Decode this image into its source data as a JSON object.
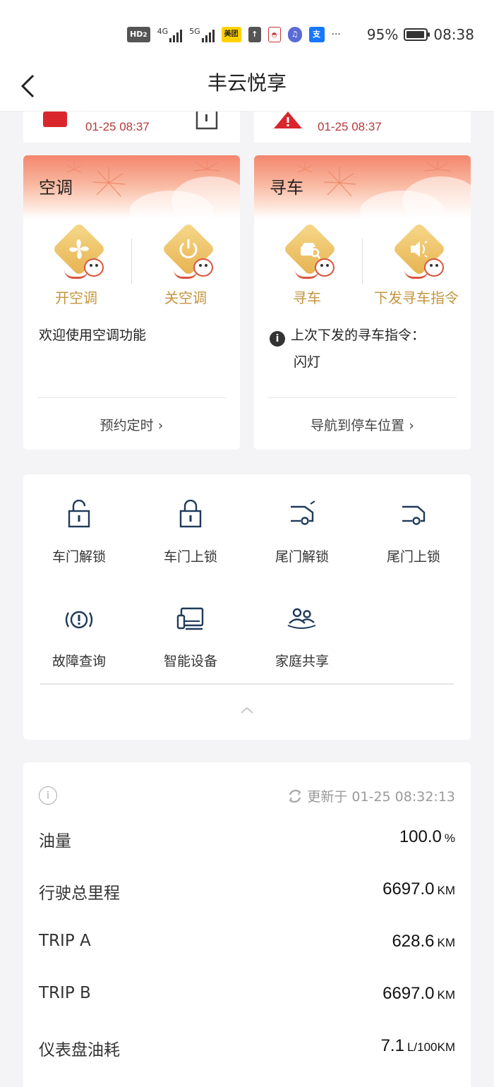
{
  "status_bar": {
    "hd": "HD",
    "hd_sub": "2",
    "net1": "4G",
    "net2": "5G",
    "meituan": "美团",
    "battery_percent": "95%",
    "battery_level": 0.95,
    "time": "08:38"
  },
  "nav": {
    "title": "丰云悦享"
  },
  "top_cards": [
    {
      "time": "01-25 08:37"
    },
    {
      "time": "01-25 08:37"
    }
  ],
  "ac_card": {
    "title": "空调",
    "actions": [
      {
        "label": "开空调",
        "icon": "fan-icon"
      },
      {
        "label": "关空调",
        "icon": "power-icon"
      }
    ],
    "message": "欢迎使用空调功能",
    "link": "预约定时"
  },
  "find_card": {
    "title": "寻车",
    "actions": [
      {
        "label": "寻车",
        "icon": "car-search-icon"
      },
      {
        "label": "下发寻车指令",
        "icon": "speaker-icon"
      }
    ],
    "message_line1": "上次下发的寻车指令：",
    "message_line2": "闪灯",
    "link": "导航到停车位置"
  },
  "quick_actions": [
    {
      "label": "车门解锁",
      "icon": "unlock-door-icon"
    },
    {
      "label": "车门上锁",
      "icon": "lock-door-icon"
    },
    {
      "label": "尾门解锁",
      "icon": "trunk-unlock-icon"
    },
    {
      "label": "尾门上锁",
      "icon": "trunk-lock-icon"
    },
    {
      "label": "故障查询",
      "icon": "fault-icon"
    },
    {
      "label": "智能设备",
      "icon": "smart-device-icon"
    },
    {
      "label": "家庭共享",
      "icon": "family-share-icon"
    }
  ],
  "stats": {
    "updated": "更新于 01-25 08:32:13",
    "rows": [
      {
        "label": "油量",
        "value": "100.0",
        "unit": "%"
      },
      {
        "label": "行驶总里程",
        "value": "6697.0",
        "unit": "KM"
      },
      {
        "label": "TRIP A",
        "value": "628.6",
        "unit": "KM"
      },
      {
        "label": "TRIP B",
        "value": "6697.0",
        "unit": "KM"
      },
      {
        "label": "仪表盘油耗",
        "value": "7.1",
        "unit": "L/100KM"
      }
    ]
  },
  "colors": {
    "accent_gold": "#c49540",
    "alert_red": "#d9262c",
    "icon_navy": "#1f3a5a"
  }
}
